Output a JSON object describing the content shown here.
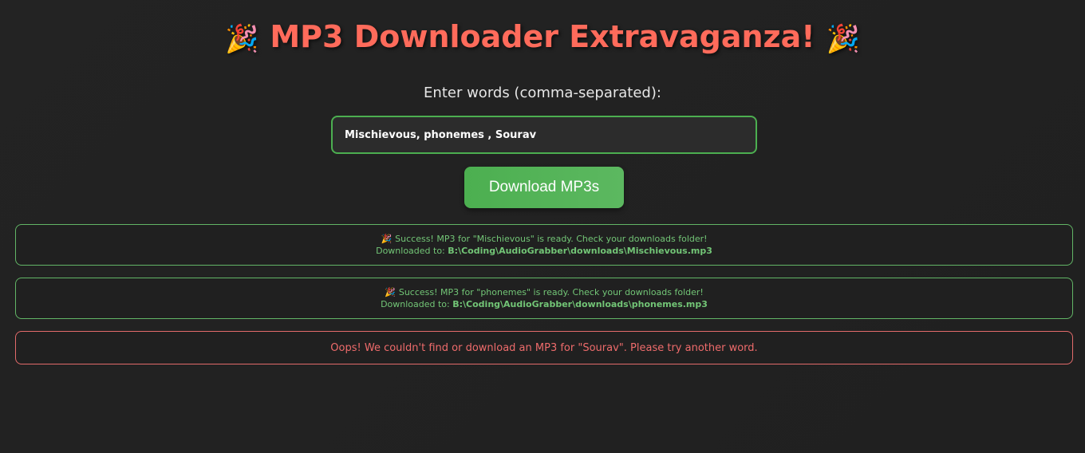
{
  "header": {
    "emoji": "🎉",
    "title": "MP3 Downloader Extravaganza!"
  },
  "form": {
    "label": "Enter words (comma-separated):",
    "input_value": "Mischievous, phonemes , Sourav",
    "button_label": "Download MP3s"
  },
  "messages": [
    {
      "emoji": "🎉",
      "text": "Success! MP3 for \"Mischievous\" is ready. Check your downloads folder!",
      "path_prefix": "Downloaded to:",
      "path": "B:\\Coding\\AudioGrabber\\downloads\\Mischievous.mp3"
    },
    {
      "emoji": "🎉",
      "text": "Success! MP3 for \"phonemes\" is ready. Check your downloads folder!",
      "path_prefix": "Downloaded to:",
      "path": "B:\\Coding\\AudioGrabber\\downloads\\phonemes.mp3"
    },
    {
      "text": "Oops! We couldn't find or download an MP3 for \"Sourav\". Please try another word."
    }
  ],
  "colors": {
    "accent": "#4caf50",
    "title": "#ff6b5b",
    "success": "#72c576",
    "error": "#ee6b6b",
    "background": "#212121"
  },
  "icons": {
    "title_icon": "party-popper-icon",
    "success_icon": "party-popper-icon"
  }
}
